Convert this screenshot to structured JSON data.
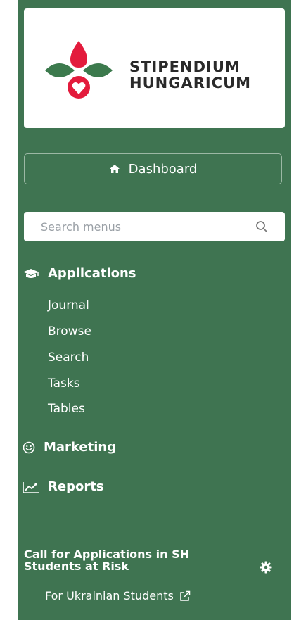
{
  "brand": {
    "line1": "STIPENDIUM",
    "line2": "HUNGARICUM",
    "colors": {
      "red": "#e31b3c",
      "green": "#3c7a4d"
    }
  },
  "dashboard": {
    "label": "Dashboard",
    "icon": "home-icon"
  },
  "search": {
    "placeholder": "Search menus",
    "icon": "search-icon"
  },
  "menu": {
    "applications": {
      "label": "Applications",
      "icon": "graduation-cap-icon",
      "items": [
        "Journal",
        "Browse",
        "Search",
        "Tasks",
        "Tables"
      ]
    },
    "marketing": {
      "label": "Marketing",
      "icon": "smile-icon"
    },
    "reports": {
      "label": "Reports",
      "icon": "line-chart-icon"
    }
  },
  "call": {
    "title_line1": "Call for Applications in SH",
    "title_line2": "Students at Risk",
    "settings_icon": "gear-icon",
    "link_label": "For Ukrainian Students",
    "link_icon": "external-link-icon"
  },
  "colors": {
    "sidebar_bg": "#3f7451",
    "text": "#ffffff"
  }
}
